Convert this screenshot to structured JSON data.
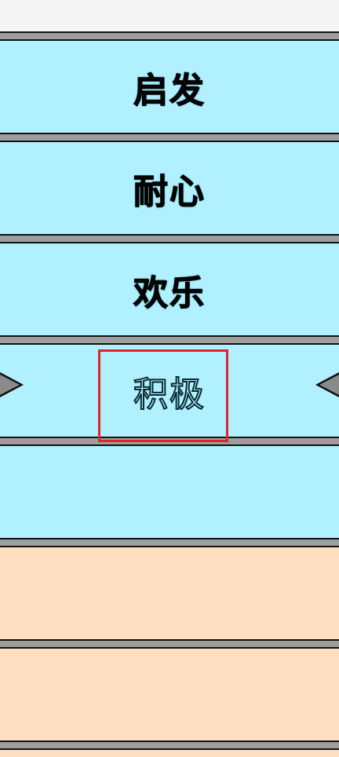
{
  "wheel": {
    "slots": [
      {
        "label": "启发",
        "style": "filled",
        "color": "#b0f0ff"
      },
      {
        "label": "耐心",
        "style": "filled",
        "color": "#b0f0ff"
      },
      {
        "label": "欢乐",
        "style": "filled",
        "color": "#b0f0ff"
      },
      {
        "label": "积极",
        "style": "outline",
        "color": "#b0f0ff",
        "selected": true
      },
      {
        "label": "",
        "style": "empty",
        "color": "#b0f0ff"
      },
      {
        "label": "",
        "style": "empty",
        "color": "#ffdfc2"
      },
      {
        "label": "",
        "style": "empty",
        "color": "#ffdfc2"
      }
    ],
    "divider_color": "#9e9e9e",
    "highlight_color": "#e0242a",
    "left_arrow_icon": "triangle-right-icon",
    "right_arrow_icon": "triangle-left-icon"
  }
}
